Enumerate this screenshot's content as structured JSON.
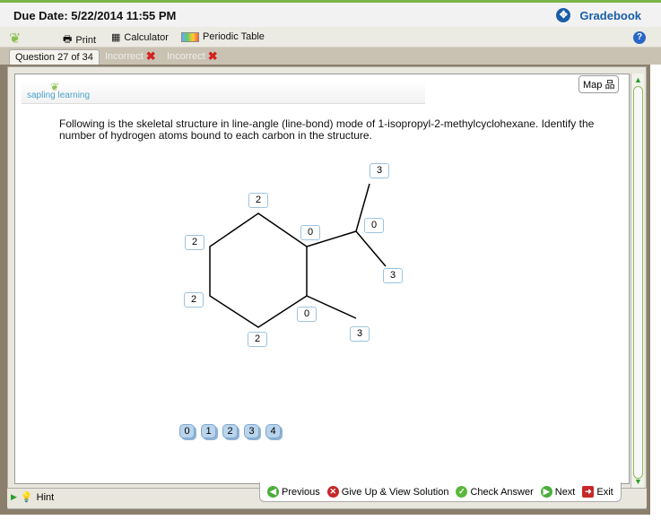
{
  "header": {
    "due_date": "Due Date:  5/22/2014 11:55 PM",
    "gradebook": "Gradebook"
  },
  "toolbar": {
    "print": "Print",
    "calculator": "Calculator",
    "periodic_table": "Periodic Table"
  },
  "tabs": {
    "current": "Question 27 of 34",
    "attempts": [
      "Incorrect",
      "Incorrect"
    ]
  },
  "logo": "sapling learning",
  "map": "Map",
  "question": "Following is the skeletal structure in line-angle (line-bond) mode of 1-isopropyl-2-methylcyclohexane. Identify the number of hydrogen atoms bound to each carbon in the structure.",
  "labels": [
    "3",
    "2",
    "0",
    "0",
    "2",
    "3",
    "2",
    "0",
    "3",
    "2"
  ],
  "palette": [
    "0",
    "1",
    "2",
    "3",
    "4"
  ],
  "hint": "Hint",
  "nav": {
    "previous": "Previous",
    "give_up": "Give Up & View Solution",
    "check": "Check Answer",
    "next": "Next",
    "exit": "Exit"
  }
}
